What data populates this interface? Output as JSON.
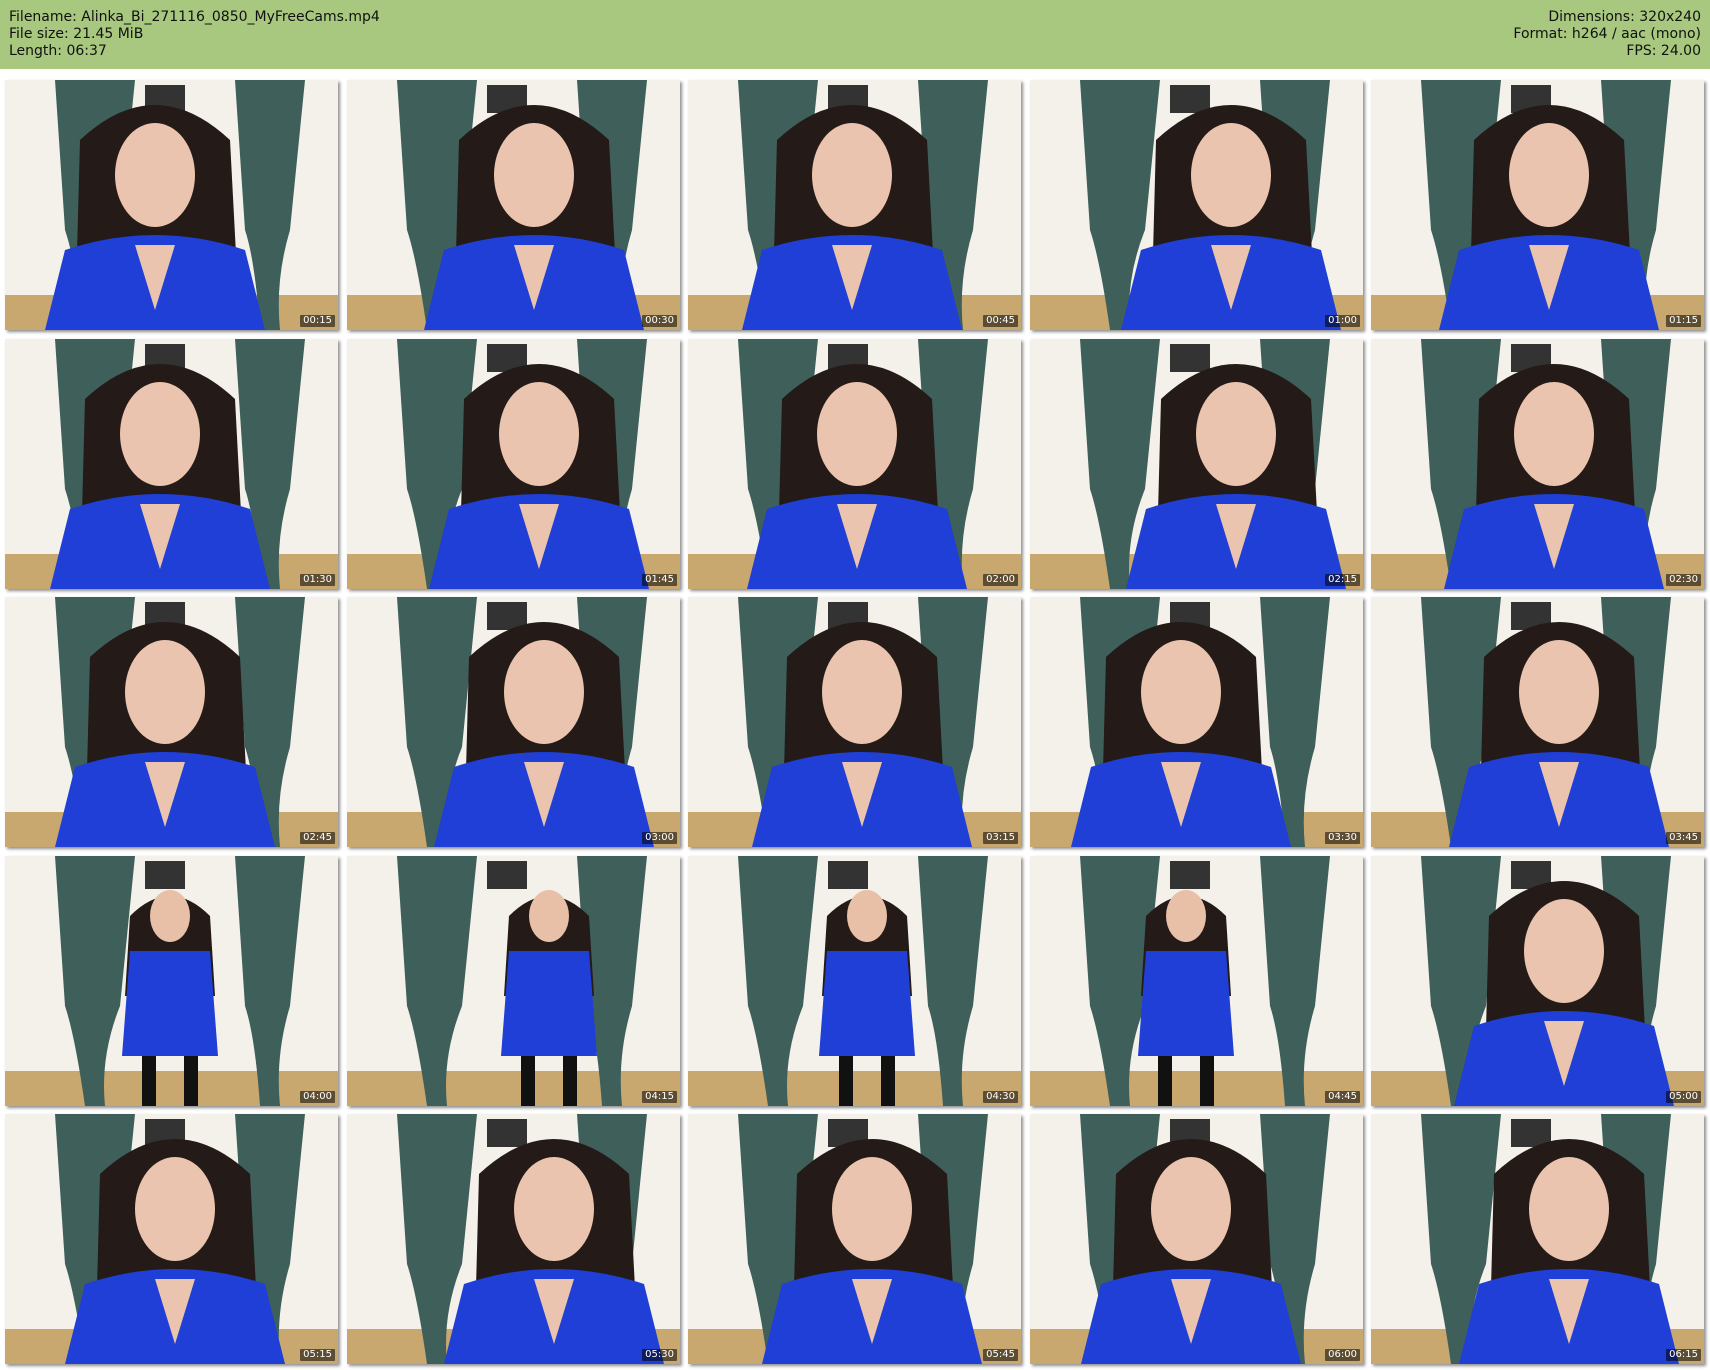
{
  "header": {
    "filename": "Filename: Alinka_Bi_271116_0850_MyFreeCams.mp4",
    "filesize": "File size: 21.45 MiB",
    "length": "Length: 06:37",
    "dimensions": "Dimensions: 320x240",
    "format": "Format: h264 / aac (mono)",
    "fps": "FPS: 24.00"
  },
  "colors": {
    "header_bg": "#a8c77f",
    "dress": "#1f3fd6",
    "curtain": "#3f5f5a",
    "hair": "#241a17",
    "wall": "#f4f1ea",
    "floor": "#c9a870"
  },
  "thumbnails": [
    {
      "timestamp": "00:15"
    },
    {
      "timestamp": "00:30"
    },
    {
      "timestamp": "00:45"
    },
    {
      "timestamp": "01:00"
    },
    {
      "timestamp": "01:15"
    },
    {
      "timestamp": "01:30"
    },
    {
      "timestamp": "01:45"
    },
    {
      "timestamp": "02:00"
    },
    {
      "timestamp": "02:15"
    },
    {
      "timestamp": "02:30"
    },
    {
      "timestamp": "02:45"
    },
    {
      "timestamp": "03:00"
    },
    {
      "timestamp": "03:15"
    },
    {
      "timestamp": "03:30"
    },
    {
      "timestamp": "03:45"
    },
    {
      "timestamp": "04:00"
    },
    {
      "timestamp": "04:15"
    },
    {
      "timestamp": "04:30"
    },
    {
      "timestamp": "04:45"
    },
    {
      "timestamp": "05:00"
    },
    {
      "timestamp": "05:15"
    },
    {
      "timestamp": "05:30"
    },
    {
      "timestamp": "05:45"
    },
    {
      "timestamp": "06:00"
    },
    {
      "timestamp": "06:15"
    }
  ]
}
